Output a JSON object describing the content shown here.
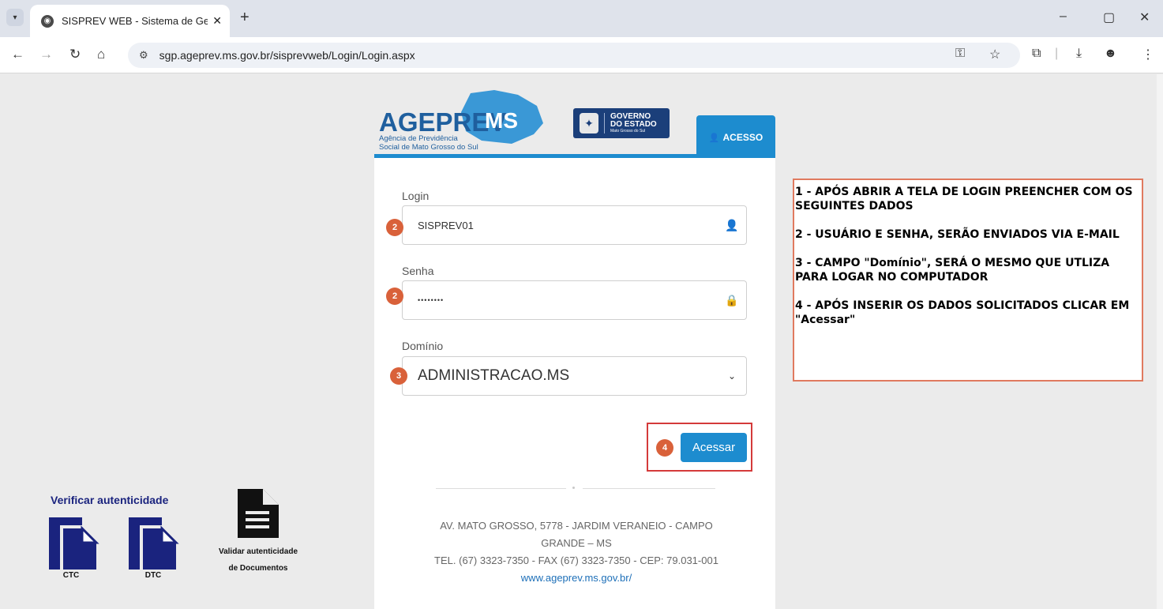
{
  "browser": {
    "tab_title": "SISPREV WEB - Sistema de Gest",
    "tab_close": "✕",
    "new_tab": "+",
    "url": "sgp.ageprev.ms.gov.br/sisprevweb/Login/Login.aspx",
    "window_controls": [
      "–",
      "▢",
      "✕"
    ]
  },
  "header": {
    "logo_name": "AGEPREV",
    "logo_ms": "MS",
    "logo_sub1": "Agência de Previdência",
    "logo_sub2": "Social de Mato Grosso do Sul",
    "gov_line1": "GOVERNO",
    "gov_line2": "DO ESTADO",
    "gov_line3": "Mato Grosso do Sul",
    "acesso_tab": "ACESSO"
  },
  "form": {
    "login_label": "Login",
    "login_value": "SISPREV01",
    "senha_label": "Senha",
    "senha_value": "••••••••",
    "dominio_label": "Domínio",
    "dominio_value": "ADMINISTRACAO.MS",
    "submit_label": "Acessar"
  },
  "badges": {
    "login": "2",
    "senha": "2",
    "dominio": "3",
    "submit": "4"
  },
  "footer": {
    "address_line1": "AV. MATO GROSSO, 5778 - JARDIM VERANEIO  - CAMPO",
    "address_line2": "GRANDE – MS",
    "phone_line": "TEL. (67) 3323-7350 - FAX (67) 3323-7350 - CEP: 79.031-001",
    "website": "www.ageprev.ms.gov.br/"
  },
  "instructions": [
    "1 - APÓS ABRIR A TELA DE LOGIN PREENCHER COM OS SEGUINTES DADOS",
    "2 - USUÁRIO E SENHA, SERÃO ENVIADOS VIA E-MAIL",
    "3 - CAMPO \"Domínio\", SERÁ O MESMO QUE UTLIZA PARA LOGAR NO COMPUTADOR",
    "4 - APÓS INSERIR OS DADOS SOLICITADOS CLICAR EM \"Acessar\""
  ],
  "verify": {
    "title": "Verificar autenticidade",
    "ctc_label": "CTC",
    "dtc_label": "DTC",
    "docs_label_1": "Validar autenticidade",
    "docs_label_2": "de Documentos"
  },
  "colors": {
    "accent": "#1d8ccf",
    "badge": "#d9613a",
    "highlight_border": "#d43a3a",
    "navy": "#1a237e"
  }
}
